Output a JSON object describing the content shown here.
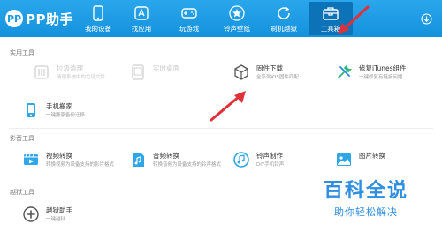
{
  "header": {
    "logo_text": "PP助手",
    "nav": [
      {
        "label": "我的设备",
        "icon": "phone-icon"
      },
      {
        "label": "找应用",
        "icon": "app-store-icon"
      },
      {
        "label": "玩游戏",
        "icon": "gamepad-icon"
      },
      {
        "label": "铃声壁纸",
        "icon": "star-icon"
      },
      {
        "label": "刷机越狱",
        "icon": "refresh-icon"
      },
      {
        "label": "工具箱",
        "icon": "toolbox-icon"
      }
    ],
    "active_nav": "工具箱",
    "download_icon": "download-icon"
  },
  "sections": [
    {
      "title": "实用工具",
      "tools": [
        {
          "name": "垃圾清理",
          "desc": "清理系统中的垃圾文件",
          "icon": "broom-icon",
          "enabled": false
        },
        {
          "name": "实时桌面",
          "desc": "",
          "icon": "desktop-icon",
          "enabled": false
        },
        {
          "name": "固件下载",
          "desc": "全系列iOS固件匹配",
          "icon": "box-icon",
          "enabled": true
        },
        {
          "name": "修复iTunes组件",
          "desc": "一键修复有链接问题",
          "icon": "wrench-icon",
          "enabled": true
        },
        {
          "name": "手机搬家",
          "desc": "一键搬家备份迁移",
          "icon": "phone-transfer-icon",
          "enabled": true
        }
      ]
    },
    {
      "title": "影音工具",
      "tools": [
        {
          "name": "视频转换",
          "desc": "转换视频为设备支持的影片格式",
          "icon": "video-icon",
          "enabled": true
        },
        {
          "name": "音频转换",
          "desc": "转换音频为设备支持的铃声格式",
          "icon": "audio-icon",
          "enabled": true
        },
        {
          "name": "铃声制作",
          "desc": "DIY手机铃声",
          "icon": "ringtone-icon",
          "enabled": true
        },
        {
          "name": "图片转换",
          "desc": "",
          "icon": "image-icon",
          "enabled": true
        }
      ]
    },
    {
      "title": "越狱工具",
      "tools": [
        {
          "name": "越狱助手",
          "desc": "一键越狱",
          "icon": "jailbreak-icon",
          "enabled": true
        }
      ]
    }
  ],
  "watermark": {
    "title": "百科全说",
    "subtitle": "助你轻松解决"
  },
  "colors": {
    "header": "#1b9ae2",
    "accent": "#2e8ee0",
    "arrow": "#e0303a"
  }
}
